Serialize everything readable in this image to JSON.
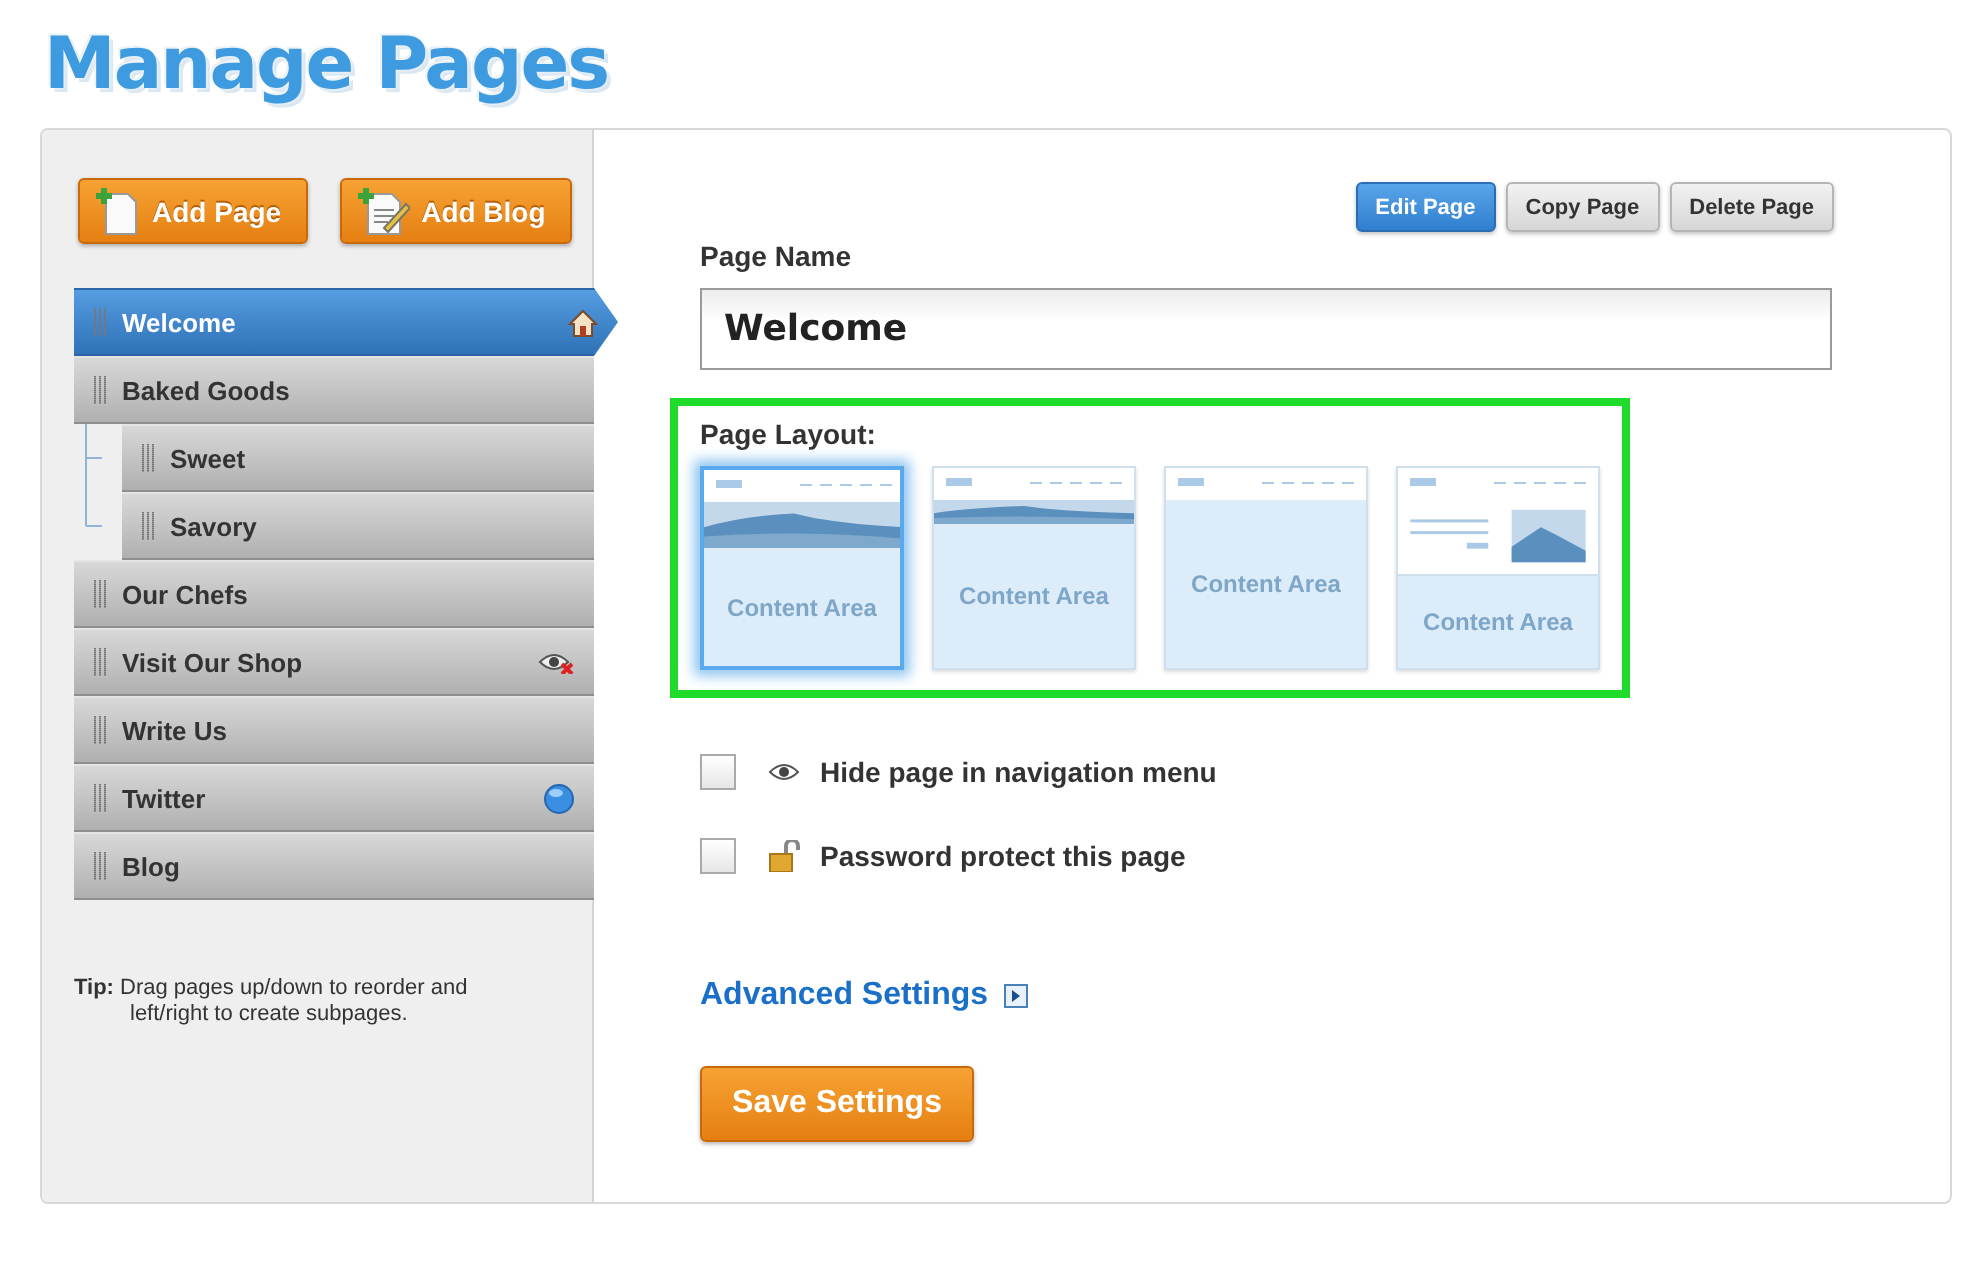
{
  "title": "Manage Pages",
  "sidebar": {
    "buttons": [
      {
        "kind": "page",
        "label": "Add Page"
      },
      {
        "kind": "blog",
        "label": "Add Blog"
      }
    ],
    "pages": [
      {
        "label": "Welcome",
        "selected": true,
        "kind": "home"
      },
      {
        "label": "Baked Goods",
        "selected": false,
        "children": [
          {
            "label": "Sweet",
            "selected": false
          },
          {
            "label": "Savory",
            "selected": false
          }
        ]
      },
      {
        "label": "Our Chefs",
        "selected": false
      },
      {
        "label": "Visit Our Shop",
        "selected": false,
        "kind": "hidden"
      },
      {
        "label": "Write Us",
        "selected": false
      },
      {
        "label": "Twitter",
        "selected": false,
        "kind": "globe"
      },
      {
        "label": "Blog",
        "selected": false
      }
    ],
    "tip": "**Tip:** Drag pages up/down to reorder and left/right to create subpages."
  },
  "toolbar": [
    {
      "label": "Edit Page",
      "selected": true
    },
    {
      "label": "Copy Page",
      "selected": false
    },
    {
      "label": "Delete Page",
      "selected": false
    }
  ],
  "page_name": {
    "label": "Page Name",
    "value": "Welcome"
  },
  "layout": {
    "label": "Page Layout:",
    "options": [
      {
        "kind": "banner-large",
        "text": "Content Area",
        "selected": true
      },
      {
        "kind": "banner-small",
        "text": "Content Area",
        "selected": false
      },
      {
        "kind": "plain",
        "text": "Content Area",
        "selected": false
      },
      {
        "kind": "side-image",
        "text": "Content Area",
        "selected": false
      }
    ]
  },
  "options": [
    {
      "kind": "eye",
      "label": "Hide page in navigation menu",
      "checked": false
    },
    {
      "kind": "lock",
      "label": "Password protect this page",
      "checked": false
    }
  ],
  "advanced": "Advanced Settings",
  "save": "Save Settings"
}
